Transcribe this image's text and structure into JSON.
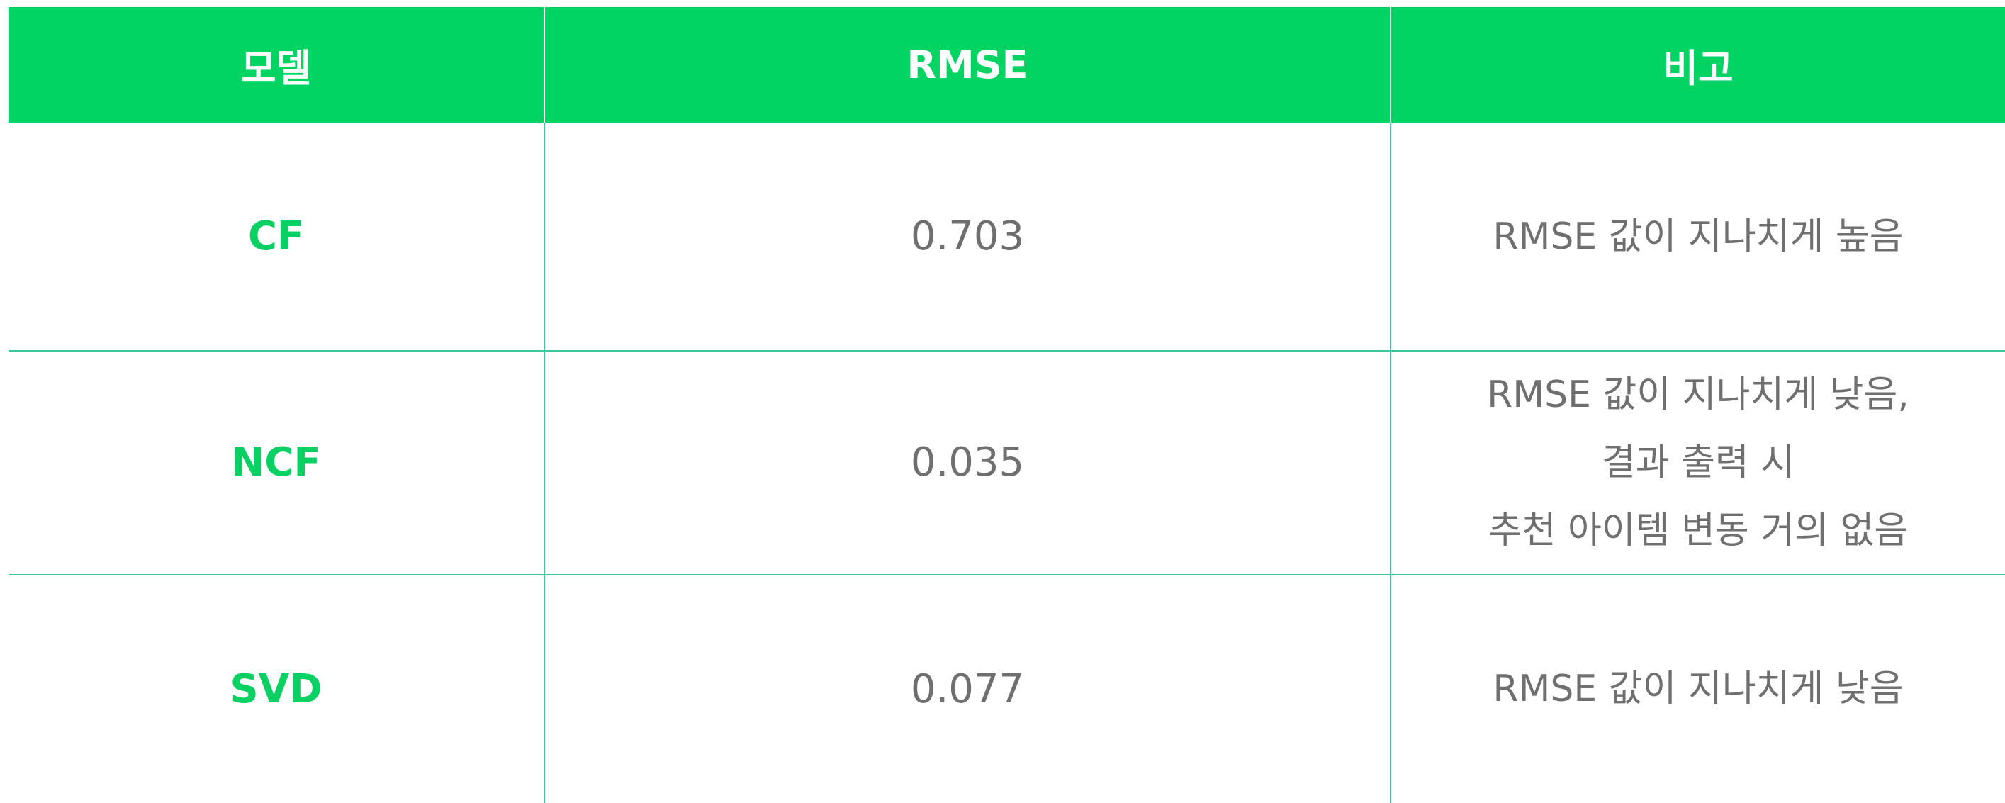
{
  "table": {
    "headers": [
      "모델",
      "RMSE",
      "비고"
    ],
    "rows": [
      {
        "model": "CF",
        "rmse": "0.703",
        "note": [
          "RMSE 값이 지나치게 높음"
        ]
      },
      {
        "model": "NCF",
        "rmse": "0.035",
        "note": [
          "RMSE 값이 지나치게 낮음,",
          "결과 출력 시",
          "추천 아이템 변동 거의 없음"
        ]
      },
      {
        "model": "SVD",
        "rmse": "0.077",
        "note": [
          "RMSE 값이 지나치게 낮음"
        ]
      }
    ]
  },
  "colors": {
    "header_bg": "#02d464",
    "header_text": "#ffffff",
    "model_text": "#08d063",
    "body_text": "#6f6f6f",
    "grid_line": "#3cc89a"
  }
}
